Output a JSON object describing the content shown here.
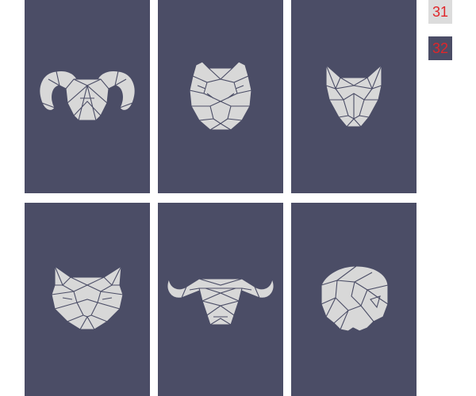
{
  "colors": {
    "card_background": "#4b4d66",
    "art_fill": "#d8d8d8",
    "swatch_light": "#dcdcdc",
    "swatch_dark": "#4b4d66",
    "swatch_text": "#e0262a"
  },
  "cards": [
    {
      "icon": "ram-head-icon"
    },
    {
      "icon": "tiger-head-icon"
    },
    {
      "icon": "wolf-head-icon"
    },
    {
      "icon": "cat-head-icon"
    },
    {
      "icon": "buffalo-head-icon"
    },
    {
      "icon": "parrot-head-icon"
    }
  ],
  "swatches": [
    {
      "label": "31"
    },
    {
      "label": "32"
    }
  ]
}
